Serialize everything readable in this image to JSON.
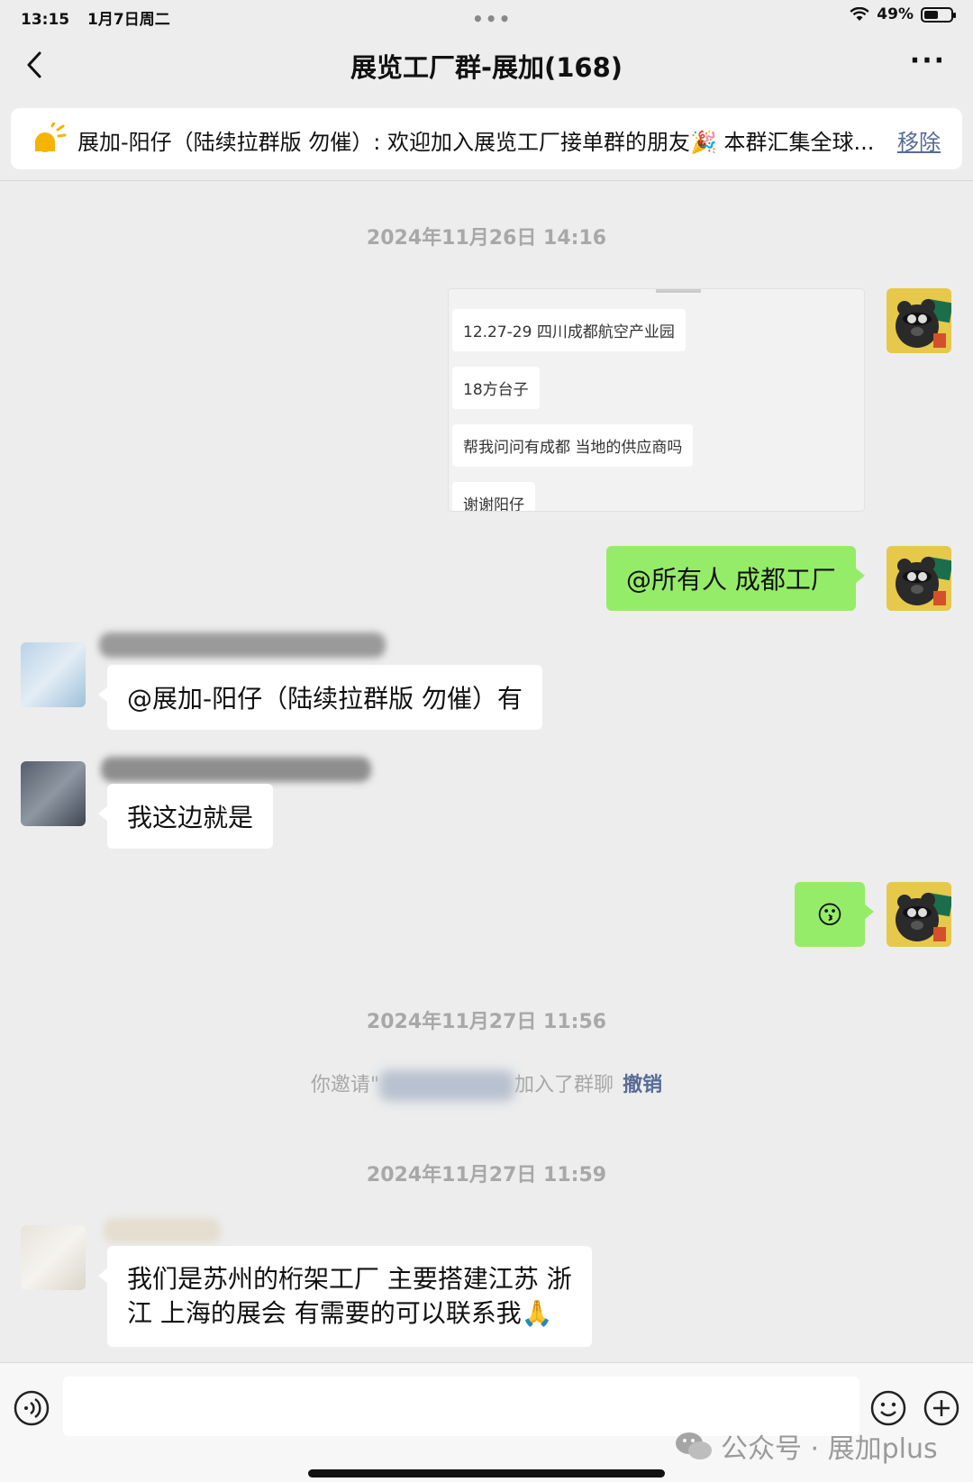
{
  "status_bar": {
    "time": "13:15",
    "date": "1月7日周二",
    "battery": "49%",
    "battery_level": 0.49
  },
  "nav": {
    "title": "展览工厂群-展加(168)",
    "more": "···"
  },
  "notice": {
    "text": "展加-阳仔（陆续拉群版 勿催）: 欢迎加入展览工厂接单群的朋友🎉 本群汇集全球...",
    "remove_label": "移除"
  },
  "messages": {
    "time1": "2024年11月26日 14:16",
    "image_lines": [
      "12.27-29 四川成都航空产业园",
      "18方台子",
      "帮我问问有成都 当地的供应商吗",
      "谢谢阳仔"
    ],
    "me_text1": "@所有人 成都工厂",
    "reply1": "@展加-阳仔（陆续拉群版 勿催）有",
    "reply2": "我这边就是",
    "me_emoji": "😗",
    "time2": "2024年11月27日 11:56",
    "system_prefix": "你邀请\"",
    "system_suffix": "加入了群聊",
    "system_revoke": "撤销",
    "time3": "2024年11月27日 11:59",
    "reply3_line1": "我们是苏州的桁架工厂 主要搭建江苏 浙",
    "reply3_line2": "江 上海的展会 有需要的可以联系我🙏"
  },
  "watermark": "公众号 · 展加plus"
}
